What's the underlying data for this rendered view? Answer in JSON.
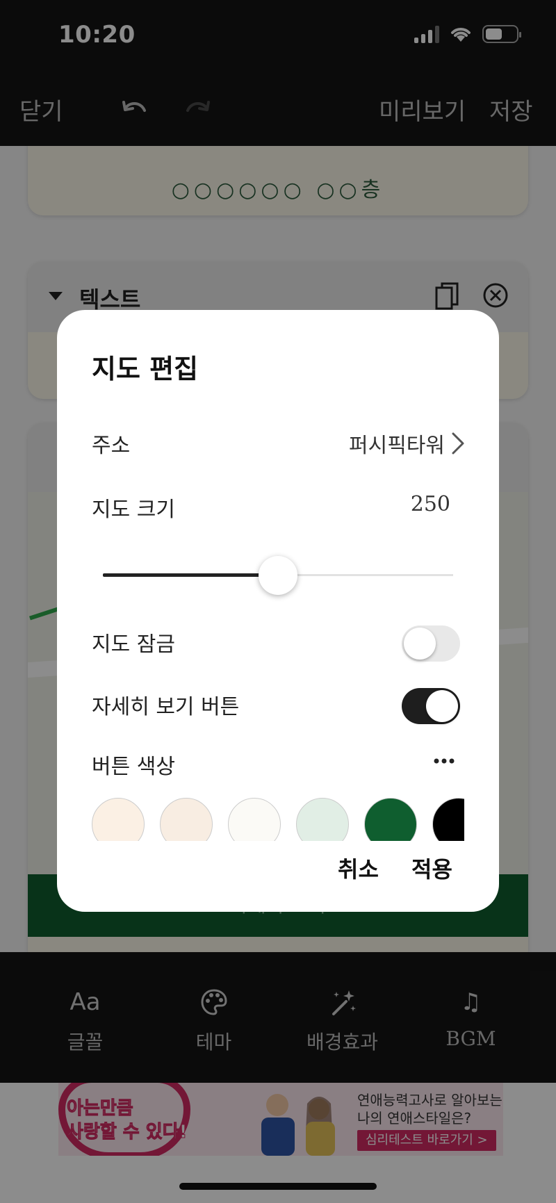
{
  "status": {
    "time": "10:20"
  },
  "header": {
    "close_label": "닫기",
    "preview_label": "미리보기",
    "save_label": "저장"
  },
  "editor": {
    "address_card_text": "○○○○○○ ○○층",
    "text_card_title": "텍스트",
    "map_detail_label": "자세히 보기"
  },
  "toolbar": {
    "items": [
      {
        "icon": "Aa",
        "label": "글꼴"
      },
      {
        "icon": "palette-icon",
        "label": "테마"
      },
      {
        "icon": "sparkle-wand-icon",
        "label": "배경효과"
      },
      {
        "icon": "♫",
        "label": "BGM"
      }
    ]
  },
  "ad": {
    "left_line1": "아는만큼",
    "left_line2": "사랑할 수 있다!",
    "right_line1": "연애능력고사로 알아보는",
    "right_line2": "나의 연애스타일은?",
    "cta": "심리테스트 바로가기 >"
  },
  "dialog": {
    "title": "지도 편집",
    "address_label": "주소",
    "address_value": "퍼시픽타워",
    "size_label": "지도 크기",
    "size_value": "250",
    "size_fraction": 0.5,
    "lock_label": "지도 잠금",
    "lock_on": false,
    "detail_button_label": "자세히 보기 버튼",
    "detail_button_on": true,
    "button_color_label": "버튼 색상",
    "swatch_colors": [
      "#fbf0e4",
      "#f8ede2",
      "#fbfaf6",
      "#e1eee5",
      "#0f5e2f",
      "#000000"
    ],
    "cancel_label": "취소",
    "apply_label": "적용"
  }
}
